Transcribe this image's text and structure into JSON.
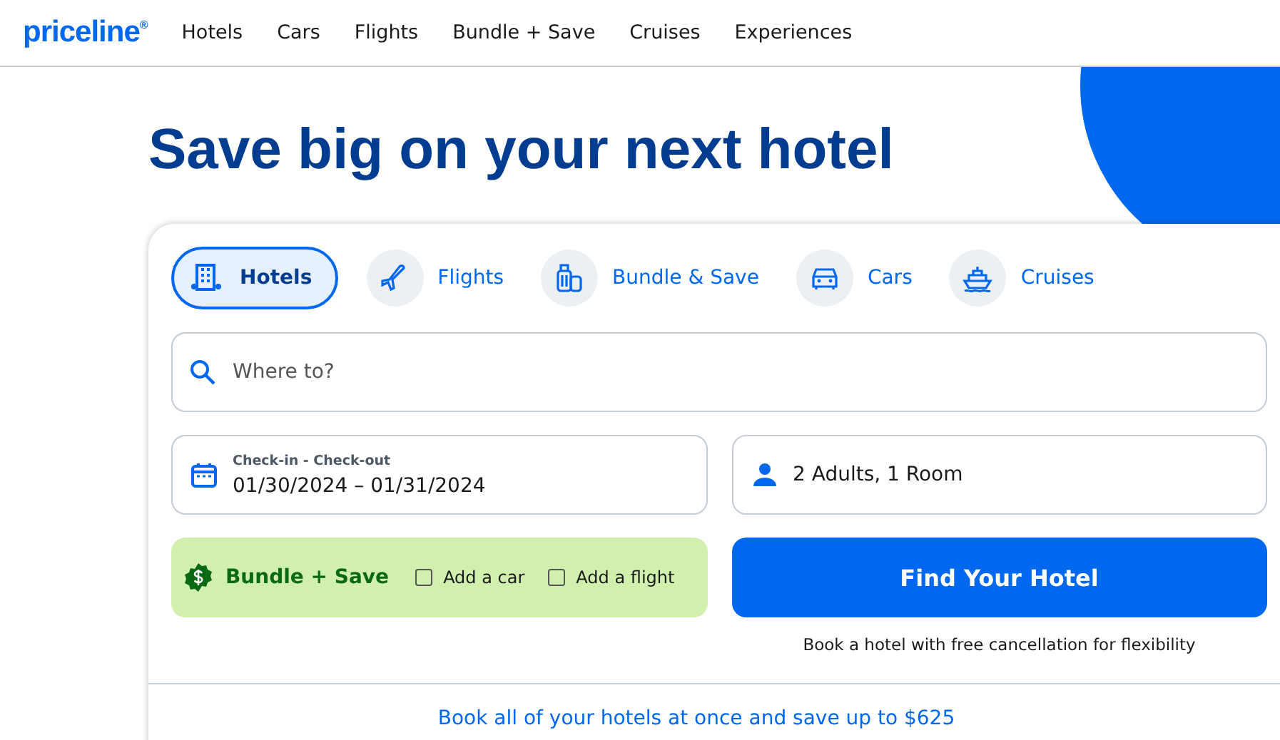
{
  "header": {
    "logo": "priceline",
    "logo_mark": "®",
    "nav": [
      "Hotels",
      "Cars",
      "Flights",
      "Bundle + Save",
      "Cruises",
      "Experiences"
    ]
  },
  "headline": "Save big on your next hotel",
  "tabs": [
    {
      "label": "Hotels",
      "kind": "hotel",
      "selected": true
    },
    {
      "label": "Flights",
      "kind": "plane",
      "selected": false
    },
    {
      "label": "Bundle & Save",
      "kind": "luggage",
      "selected": false
    },
    {
      "label": "Cars",
      "kind": "car",
      "selected": false
    },
    {
      "label": "Cruises",
      "kind": "ship",
      "selected": false
    }
  ],
  "destination": {
    "placeholder": "Where to?"
  },
  "dates": {
    "label": "Check-in - Check-out",
    "value": "01/30/2024 – 01/31/2024"
  },
  "guests": {
    "value": "2 Adults, 1 Room"
  },
  "bundle": {
    "title": "Bundle + Save",
    "options": [
      {
        "label": "Add a car",
        "checked": false
      },
      {
        "label": "Add a flight",
        "checked": false
      }
    ]
  },
  "search_button": "Find Your Hotel",
  "note": "Book a hotel with free cancellation for flexibility",
  "promo_link": "Book all of your hotels at once and save up to $625"
}
